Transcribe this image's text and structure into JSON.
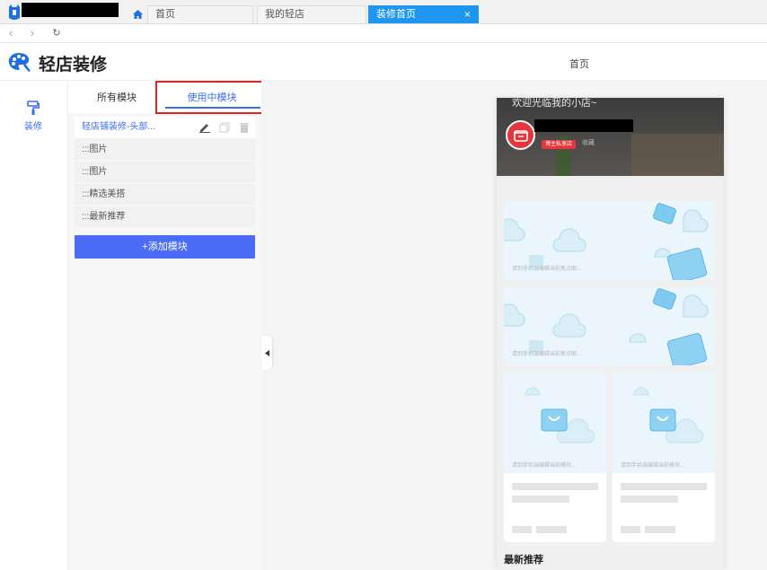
{
  "tabbar": {
    "tabs": [
      {
        "label": "首页"
      },
      {
        "label": "我的轻店"
      },
      {
        "label": "装修首页",
        "close": "×"
      }
    ]
  },
  "nav": {
    "back": "‹",
    "forward": "›",
    "refresh": "↻"
  },
  "header": {
    "brand": "轻店装修",
    "page": "首页"
  },
  "rail": {
    "item_label": "装修"
  },
  "panel": {
    "tab_all": "所有模块",
    "tab_used": "使用中模块",
    "modules": [
      {
        "label": "轻店铺装修-头部..."
      },
      {
        "label": ":::图片"
      },
      {
        "label": ":::图片"
      },
      {
        "label": ":::精选美搭"
      },
      {
        "label": ":::最新推荐"
      }
    ],
    "add_button": "+添加模块"
  },
  "preview": {
    "welcome": "欢迎光临我的小店~",
    "badge": "博主私享店",
    "fav": "收藏",
    "card_hint": "请到手机端编辑当前焦点图...",
    "half_hint": "请到手机端编辑当前模块...",
    "section_title": "最新推荐"
  },
  "colors": {
    "accent": "#3b6cf6",
    "tab_active": "#1e96f0",
    "highlight": "#e32222",
    "shop_red": "#e6353c"
  }
}
